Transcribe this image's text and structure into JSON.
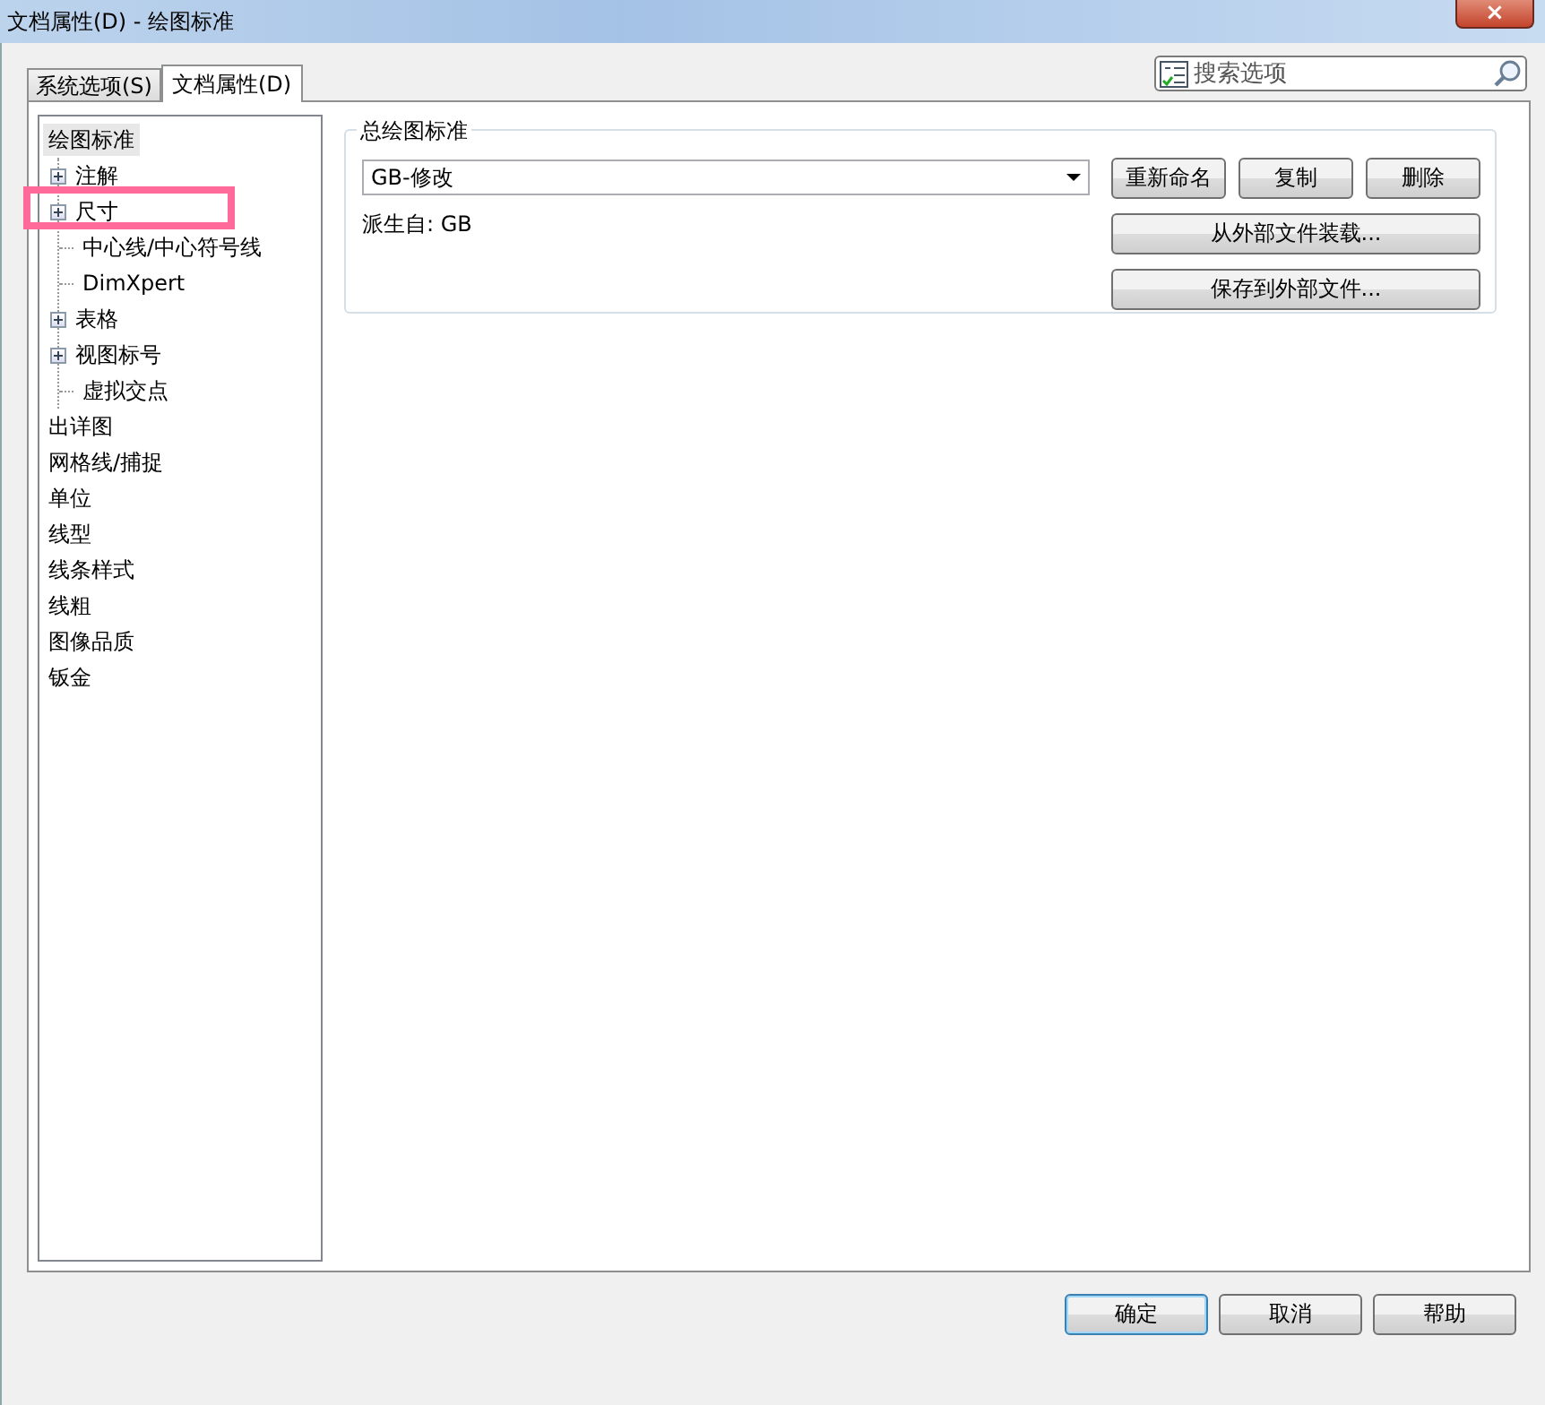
{
  "window": {
    "title": "文档属性(D) - 绘图标准",
    "close": "×"
  },
  "tabs": [
    {
      "label": "系统选项(S)",
      "selected": false
    },
    {
      "label": "文档属性(D)",
      "selected": true
    }
  ],
  "search": {
    "placeholder": "搜索选项"
  },
  "tree": [
    {
      "label": "绘图标准",
      "selected": true,
      "children": [
        {
          "label": "注解",
          "selected": false,
          "kind": "branch"
        },
        {
          "label": "尺寸",
          "selected": false,
          "highlighted": true,
          "kind": "branch"
        },
        {
          "label": "中心线/中心符号线",
          "selected": false,
          "kind": "leaf"
        },
        {
          "label": "DimXpert",
          "selected": false,
          "kind": "leaf"
        },
        {
          "label": "表格",
          "selected": false,
          "kind": "branch"
        },
        {
          "label": "视图标号",
          "selected": false,
          "kind": "branch"
        },
        {
          "label": "虚拟交点",
          "selected": false,
          "kind": "leaf"
        }
      ]
    },
    {
      "label": "出详图",
      "selected": false
    },
    {
      "label": "网格线/捕捉",
      "selected": false
    },
    {
      "label": "单位",
      "selected": false
    },
    {
      "label": "线型",
      "selected": false
    },
    {
      "label": "线条样式",
      "selected": false
    },
    {
      "label": "线粗",
      "selected": false
    },
    {
      "label": "图像品质",
      "selected": false
    },
    {
      "label": "钣金",
      "selected": false
    }
  ],
  "group": {
    "title": "总绘图标准",
    "dropdown": {
      "value": "GB-修改"
    },
    "derived_label": "派生自: GB",
    "buttons": [
      "重新命名",
      "复制",
      "删除"
    ],
    "wide_buttons": [
      "从外部文件装载...",
      "保存到外部文件..."
    ]
  },
  "footer_buttons": [
    {
      "label": "确定",
      "selected": true
    },
    {
      "label": "取消",
      "selected": false
    },
    {
      "label": "帮助",
      "selected": false
    }
  ]
}
